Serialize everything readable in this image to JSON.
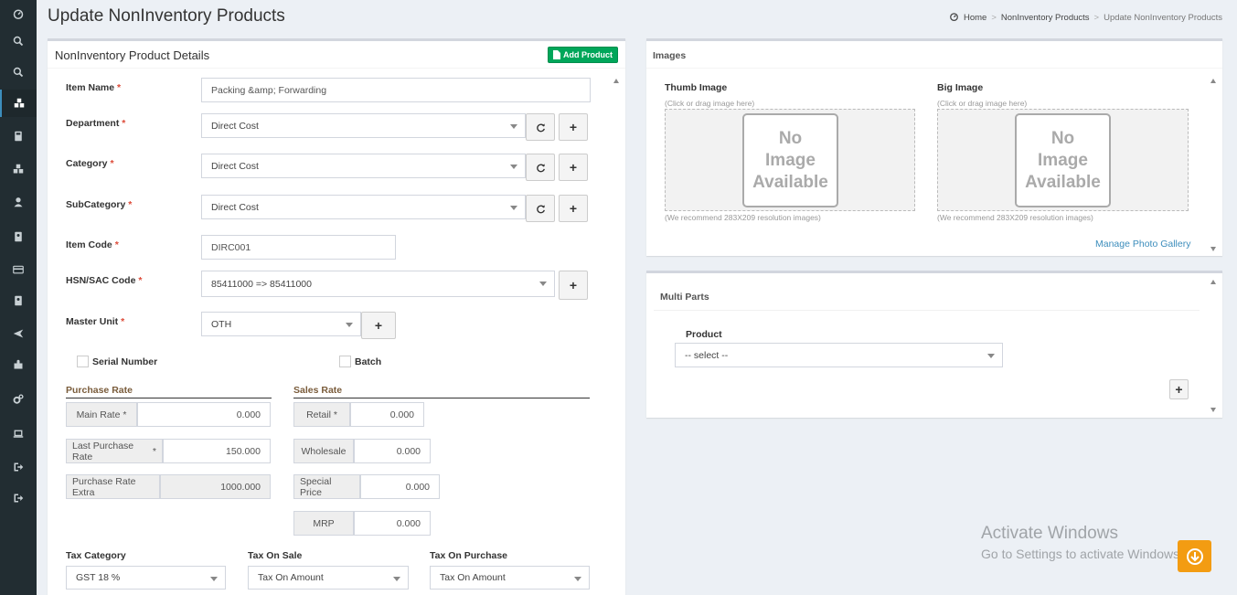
{
  "page": {
    "title": "Update NonInventory Products",
    "breadcrumb": [
      "Home",
      "NonInventory Products",
      "Update NonInventory Products"
    ]
  },
  "sidebar": {
    "icons": [
      "dashboard-icon",
      "search-icon",
      "search-icon",
      "cubes-icon",
      "calculator-icon",
      "cubes-icon",
      "user-icon",
      "id-card-icon",
      "credit-card-icon",
      "id-card-icon",
      "plane-icon",
      "puzzle-icon",
      "cogs-icon",
      "laptop-icon",
      "sign-out-icon",
      "sign-out-icon"
    ]
  },
  "details": {
    "title": "NonInventory Product Details",
    "add_label": "Add Product",
    "item_name": {
      "label": "Item Name",
      "value": "Packing &amp; Forwarding"
    },
    "department": {
      "label": "Department",
      "value": "Direct Cost"
    },
    "category": {
      "label": "Category",
      "value": "Direct Cost"
    },
    "subcategory": {
      "label": "SubCategory",
      "value": "Direct Cost"
    },
    "item_code": {
      "label": "Item Code",
      "value": "DIRC001"
    },
    "hsn": {
      "label": "HSN/SAC Code",
      "value": "85411000 => 85411000"
    },
    "master_unit": {
      "label": "Master Unit",
      "value": "OTH"
    },
    "serial_number": "Serial Number",
    "batch": "Batch",
    "req": "*",
    "plus": "+",
    "purchase": {
      "title": "Purchase Rate",
      "main_label": "Main Rate",
      "main_value": "0.000",
      "last_label": "Last Purchase Rate",
      "last_value": "150.000",
      "extra_label": "Purchase Rate Extra",
      "extra_value": "1000.000"
    },
    "sales": {
      "title": "Sales Rate",
      "retail_label": "Retail",
      "retail_value": "0.000",
      "wholesale_label": "Wholesale",
      "wholesale_value": "0.000",
      "special_label": "Special Price",
      "special_value": "0.000",
      "mrp_label": "MRP",
      "mrp_value": "0.000"
    },
    "tax": {
      "category_label": "Tax Category",
      "category_value": "GST 18 %",
      "sale_label": "Tax On Sale",
      "sale_value": "Tax On Amount",
      "purchase_label": "Tax On Purchase",
      "purchase_value": "Tax On Amount"
    }
  },
  "images": {
    "title": "Images",
    "thumb": {
      "label": "Thumb Image",
      "hint": "(Click or drag image here)",
      "recommend": "(We recommend 283X209 resolution images)"
    },
    "big": {
      "label": "Big Image",
      "hint": "(Click or drag image here)",
      "recommend": "(We recommend 283X209 resolution images)"
    },
    "no_image": [
      "No",
      "Image",
      "Available"
    ],
    "gallery_link": "Manage Photo Gallery"
  },
  "multi_parts": {
    "title": "Multi Parts",
    "product_label": "Product",
    "product_value": "-- select --",
    "plus": "+"
  },
  "watermark": {
    "line1": "Activate Windows",
    "line2": "Go to Settings to activate Windows."
  }
}
